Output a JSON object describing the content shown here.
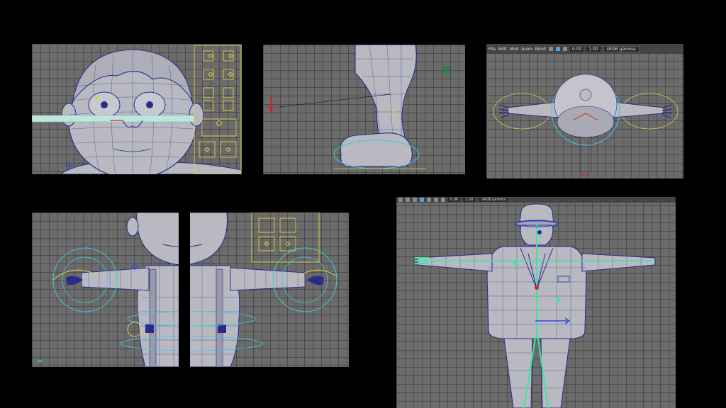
{
  "colors": {
    "background": "#000000",
    "viewport": "#6b6b6b",
    "mesh_fill": "#b9b9c2",
    "wire": "#2a2a8a",
    "joint_green": "#39e8a0",
    "control_yellow": "#e0d040",
    "control_cyan": "#40c8e0",
    "selection_red": "#e02020"
  },
  "panel_top_right": {
    "menu": [
      "File",
      "Edit",
      "Mod",
      "Anim",
      "Rend"
    ],
    "zoom": "0.00",
    "scale": "1.00",
    "color_space": "sRGB gamma"
  },
  "panel_bottom_right": {
    "zoom": "0.00",
    "scale": "1.00",
    "color_space": "sRGB gamma"
  }
}
